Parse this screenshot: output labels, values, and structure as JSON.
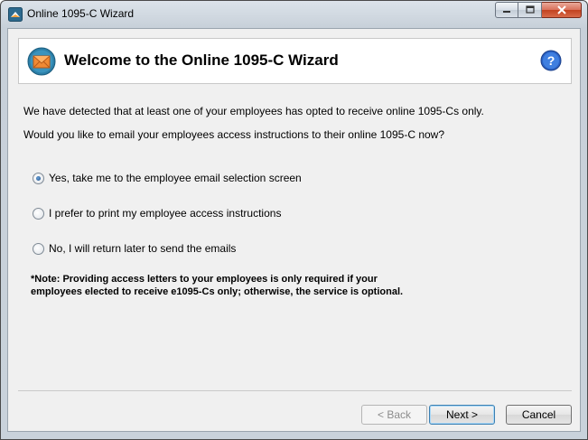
{
  "window": {
    "title": "Online 1095-C Wizard"
  },
  "header": {
    "title": "Welcome to the Online 1095-C Wizard"
  },
  "body": {
    "para1": "We have detected that at least one of your employees has opted to receive online 1095-Cs only.",
    "para2": "Would you like to email your employees access instructions to their online 1095-C now?"
  },
  "options": [
    {
      "label": "Yes, take me to the employee email selection screen",
      "selected": true
    },
    {
      "label": "I prefer to print my employee access instructions",
      "selected": false
    },
    {
      "label": "No, I will return later to send the emails",
      "selected": false
    }
  ],
  "note": {
    "line1": "*Note: Providing access letters to your employees is only required if your",
    "line2": "employees elected to receive e1095-Cs only; otherwise, the service is optional."
  },
  "buttons": {
    "back": "< Back",
    "next": "Next >",
    "cancel": "Cancel"
  },
  "colors": {
    "accent": "#3c7fb1",
    "envelope": "#e8742a",
    "help": "#2b62c4"
  }
}
